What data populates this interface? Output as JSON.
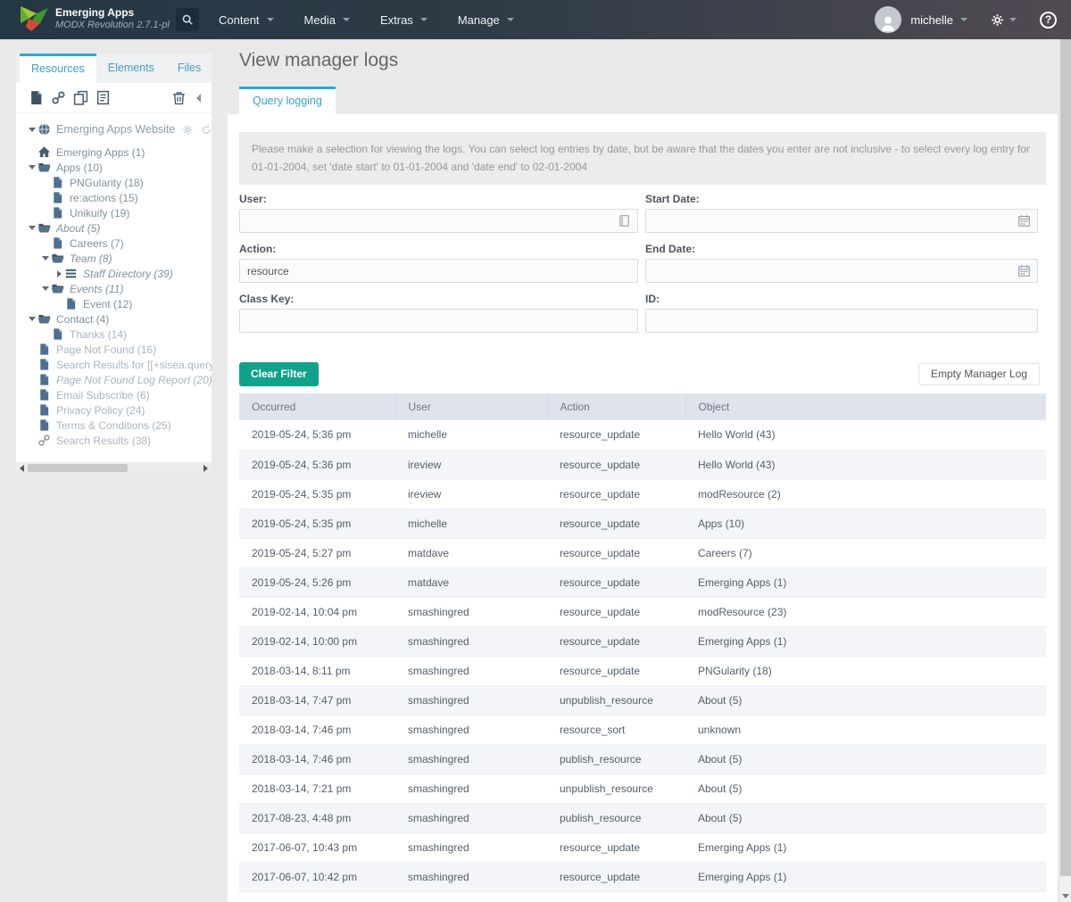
{
  "header": {
    "app_title": "Emerging Apps",
    "app_subtitle": "MODX Revolution 2.7.1-pl",
    "nav": [
      {
        "label": "Content"
      },
      {
        "label": "Media"
      },
      {
        "label": "Extras"
      },
      {
        "label": "Manage"
      }
    ],
    "username": "michelle",
    "help_glyph": "?"
  },
  "sidebar": {
    "tabs": [
      {
        "label": "Resources",
        "active": true
      },
      {
        "label": "Elements",
        "active": false
      },
      {
        "label": "Files",
        "active": false
      }
    ],
    "tree_root": "Emerging Apps Website",
    "tree": [
      {
        "label": "Emerging Apps (1)",
        "icon": "home",
        "level": 1,
        "caret": null,
        "italic": false,
        "muted": false
      },
      {
        "label": "Apps (10)",
        "icon": "folder",
        "level": 1,
        "caret": "down",
        "italic": false,
        "muted": false
      },
      {
        "label": "PNGularity (18)",
        "icon": "doc",
        "level": 2,
        "caret": null,
        "italic": false,
        "muted": false
      },
      {
        "label": "re:actions (15)",
        "icon": "doc",
        "level": 2,
        "caret": null,
        "italic": false,
        "muted": false
      },
      {
        "label": "Unikuify (19)",
        "icon": "doc",
        "level": 2,
        "caret": null,
        "italic": false,
        "muted": false
      },
      {
        "label": "About (5)",
        "icon": "folder",
        "level": 1,
        "caret": "down",
        "italic": true,
        "muted": false
      },
      {
        "label": "Careers (7)",
        "icon": "doc",
        "level": 2,
        "caret": null,
        "italic": false,
        "muted": false
      },
      {
        "label": "Team (8)",
        "icon": "folder",
        "level": 2,
        "caret": "down",
        "italic": true,
        "muted": false
      },
      {
        "label": "Staff Directory (39)",
        "icon": "list",
        "level": 3,
        "caret": "right",
        "italic": true,
        "muted": false
      },
      {
        "label": "Events (11)",
        "icon": "folder",
        "level": 2,
        "caret": "down",
        "italic": true,
        "muted": false
      },
      {
        "label": "Event (12)",
        "icon": "doc",
        "level": 3,
        "caret": null,
        "italic": false,
        "muted": false
      },
      {
        "label": "Contact (4)",
        "icon": "folder",
        "level": 1,
        "caret": "down",
        "italic": false,
        "muted": false
      },
      {
        "label": "Thanks (14)",
        "icon": "doc",
        "level": 2,
        "caret": null,
        "italic": false,
        "muted": true
      },
      {
        "label": "Page Not Found (16)",
        "icon": "doc",
        "level": 1,
        "caret": null,
        "italic": false,
        "muted": true
      },
      {
        "label": "Search Results for [[+sisea.query]] (",
        "icon": "doc",
        "level": 1,
        "caret": null,
        "italic": false,
        "muted": true
      },
      {
        "label": "Page Not Found Log Report (20)",
        "icon": "doc",
        "level": 1,
        "caret": null,
        "italic": true,
        "muted": true
      },
      {
        "label": "Email Subscribe (6)",
        "icon": "doc",
        "level": 1,
        "caret": null,
        "italic": false,
        "muted": true
      },
      {
        "label": "Privacy Policy (24)",
        "icon": "doc",
        "level": 1,
        "caret": null,
        "italic": false,
        "muted": true
      },
      {
        "label": "Terms & Conditions (25)",
        "icon": "doc",
        "level": 1,
        "caret": null,
        "italic": false,
        "muted": true
      },
      {
        "label": "Search Results (38)",
        "icon": "link",
        "level": 1,
        "caret": null,
        "italic": false,
        "muted": true
      }
    ]
  },
  "main": {
    "title": "View manager logs",
    "tab_label": "Query logging",
    "instructions": "Please make a selection for viewing the logs. You can select log entries by date, but be aware that the dates you enter are not inclusive - to select every log entry for 01-01-2004, set 'date start' to 01-01-2004 and 'date end' to 02-01-2004",
    "form": {
      "user_label": "User:",
      "user_value": "",
      "action_label": "Action:",
      "action_value": "resource",
      "classkey_label": "Class Key:",
      "classkey_value": "",
      "startdate_label": "Start Date:",
      "startdate_value": "",
      "enddate_label": "End Date:",
      "enddate_value": "",
      "id_label": "ID:",
      "id_value": ""
    },
    "clear_filter_label": "Clear Filter",
    "empty_log_label": "Empty Manager Log"
  },
  "table": {
    "columns": [
      "Occurred",
      "User",
      "Action",
      "Object"
    ],
    "rows": [
      [
        "2019-05-24, 5:36 pm",
        "michelle",
        "resource_update",
        "Hello World (43)"
      ],
      [
        "2019-05-24, 5:36 pm",
        "ireview",
        "resource_update",
        "Hello World (43)"
      ],
      [
        "2019-05-24, 5:35 pm",
        "ireview",
        "resource_update",
        "modResource (2)"
      ],
      [
        "2019-05-24, 5:35 pm",
        "michelle",
        "resource_update",
        "Apps (10)"
      ],
      [
        "2019-05-24, 5:27 pm",
        "matdave",
        "resource_update",
        "Careers (7)"
      ],
      [
        "2019-05-24, 5:26 pm",
        "matdave",
        "resource_update",
        "Emerging Apps (1)"
      ],
      [
        "2019-02-14, 10:04 pm",
        "smashingred",
        "resource_update",
        "modResource (23)"
      ],
      [
        "2019-02-14, 10:00 pm",
        "smashingred",
        "resource_update",
        "Emerging Apps (1)"
      ],
      [
        "2018-03-14, 8:11 pm",
        "smashingred",
        "resource_update",
        "PNGularity (18)"
      ],
      [
        "2018-03-14, 7:47 pm",
        "smashingred",
        "unpublish_resource",
        "About (5)"
      ],
      [
        "2018-03-14, 7:46 pm",
        "smashingred",
        "resource_sort",
        "unknown"
      ],
      [
        "2018-03-14, 7:46 pm",
        "smashingred",
        "publish_resource",
        "About (5)"
      ],
      [
        "2018-03-14, 7:21 pm",
        "smashingred",
        "unpublish_resource",
        "About (5)"
      ],
      [
        "2017-08-23, 4:48 pm",
        "smashingred",
        "publish_resource",
        "About (5)"
      ],
      [
        "2017-06-07, 10:43 pm",
        "smashingred",
        "resource_update",
        "Emerging Apps (1)"
      ],
      [
        "2017-06-07, 10:42 pm",
        "smashingred",
        "resource_update",
        "Emerging Apps (1)"
      ]
    ]
  },
  "colors": {
    "accent_blue": "#2aa9d9",
    "button_green": "#12a28b",
    "header_dark": "#24374a"
  }
}
